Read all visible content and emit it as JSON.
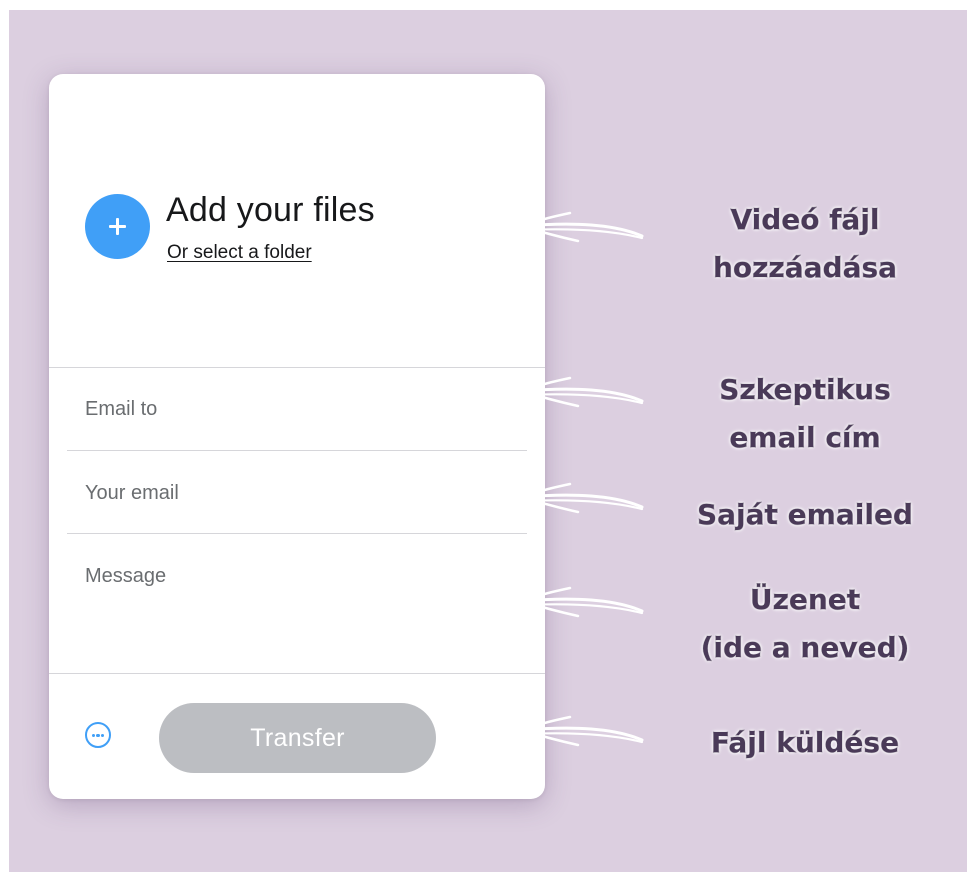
{
  "upload": {
    "title": "Add your files",
    "folder_link": "Or select a folder"
  },
  "form": {
    "email_to": "Email to",
    "your_email": "Your email",
    "message": "Message"
  },
  "actions": {
    "transfer_label": "Transfer"
  },
  "annotations": {
    "files": [
      "Videó fájl",
      "hozzáadása"
    ],
    "email_to": [
      "Szkeptikus",
      "email cím"
    ],
    "your_email": [
      "Saját emailed"
    ],
    "message": [
      "Üzenet",
      "(ide a neved)"
    ],
    "send": [
      "Fájl küldése"
    ]
  },
  "colors": {
    "background": "#dccfe0",
    "accent": "#409ff7",
    "button_disabled": "#bcbec2",
    "annotation_text": "#4a3a58"
  },
  "icons": {
    "add": "plus-icon",
    "more": "more-options-icon",
    "annotation_arrow": "hand-drawn-arrow-left-icon"
  }
}
